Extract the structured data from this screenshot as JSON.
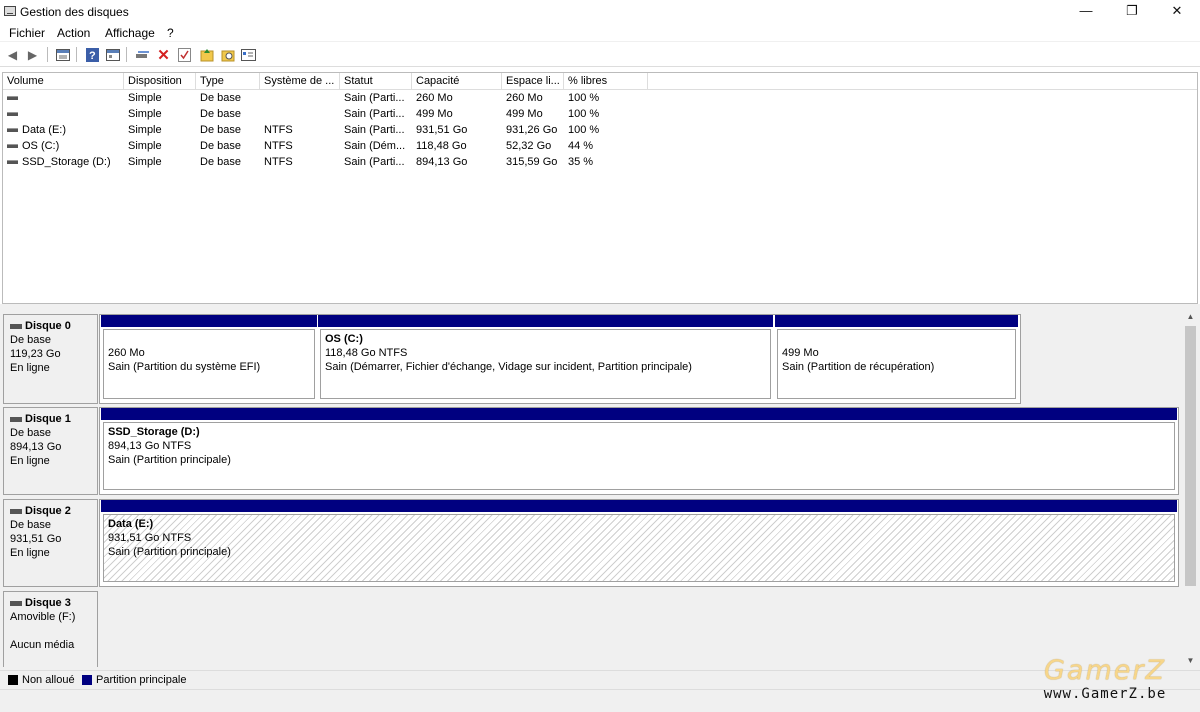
{
  "window": {
    "title": "Gestion des disques",
    "minimize": "—",
    "maximize": "❐",
    "close": "✕"
  },
  "menu": [
    "Fichier",
    "Action",
    "Affichage",
    "?"
  ],
  "toolbar": {
    "icons": [
      "back-icon",
      "forward-icon",
      "list-view-icon",
      "help-icon",
      "properties-view-icon",
      "connect-disk-icon",
      "delete-icon",
      "checkmark-icon",
      "folder-up-icon",
      "folder-search-icon",
      "properties-icon"
    ]
  },
  "volumes": {
    "headers": [
      "Volume",
      "Disposition",
      "Type",
      "Système de ...",
      "Statut",
      "Capacité",
      "Espace li...",
      "% libres"
    ],
    "rows": [
      [
        "",
        "Simple",
        "De base",
        "",
        "Sain (Parti...",
        "260 Mo",
        "260 Mo",
        "100 %"
      ],
      [
        "",
        "Simple",
        "De base",
        "",
        "Sain (Parti...",
        "499 Mo",
        "499 Mo",
        "100 %"
      ],
      [
        "Data (E:)",
        "Simple",
        "De base",
        "NTFS",
        "Sain (Parti...",
        "931,51 Go",
        "931,26 Go",
        "100 %"
      ],
      [
        "OS (C:)",
        "Simple",
        "De base",
        "NTFS",
        "Sain (Dém...",
        "118,48 Go",
        "52,32 Go",
        "44 %"
      ],
      [
        "SSD_Storage (D:)",
        "Simple",
        "De base",
        "NTFS",
        "Sain (Parti...",
        "894,13 Go",
        "315,59 Go",
        "35 %"
      ]
    ]
  },
  "disks": [
    {
      "name": "Disque 0",
      "type": "De base",
      "size": "119,23 Go",
      "status": "En ligne",
      "partitions": [
        {
          "name": "",
          "size": "260 Mo",
          "status": "Sain (Partition du système EFI)"
        },
        {
          "name": "OS  (C:)",
          "size": "118,48 Go NTFS",
          "status": "Sain (Démarrer, Fichier d'échange, Vidage sur incident, Partition principale)"
        },
        {
          "name": "",
          "size": "499 Mo",
          "status": "Sain (Partition de récupération)"
        }
      ]
    },
    {
      "name": "Disque 1",
      "type": "De base",
      "size": "894,13 Go",
      "status": "En ligne",
      "partitions": [
        {
          "name": "SSD_Storage  (D:)",
          "size": "894,13 Go NTFS",
          "status": "Sain (Partition principale)"
        }
      ]
    },
    {
      "name": "Disque 2",
      "type": "De base",
      "size": "931,51 Go",
      "status": "En ligne",
      "partitions": [
        {
          "name": "Data  (E:)",
          "size": "931,51 Go NTFS",
          "status": "Sain (Partition principale)"
        }
      ]
    },
    {
      "name": "Disque 3",
      "type": "Amovible (F:)",
      "size": "",
      "status": "Aucun média"
    }
  ],
  "legend": {
    "unallocated": "Non alloué",
    "primary": "Partition principale"
  },
  "colors": {
    "primary_partition": "#000080",
    "unallocated": "#000000"
  },
  "watermark": {
    "logo": "GamerZ",
    "url": "www.GamerZ.be"
  }
}
